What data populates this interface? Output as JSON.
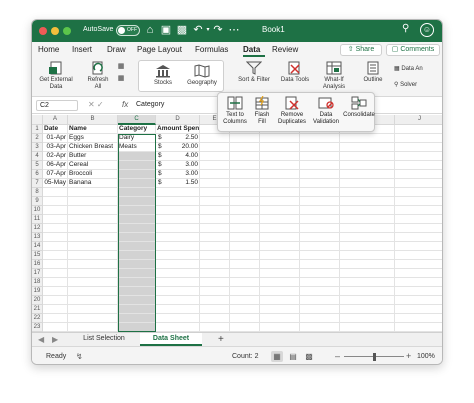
{
  "title_bar": {
    "autosave_label": "AutoSave",
    "autosave_state": "OFF",
    "document_title": "Book1",
    "icons": [
      "home-icon",
      "save-icon",
      "undo-icon",
      "redo-icon",
      "search-icon",
      "smile-icon"
    ]
  },
  "ribbon_tabs": [
    {
      "label": "Home"
    },
    {
      "label": "Insert"
    },
    {
      "label": "Draw"
    },
    {
      "label": "Page Layout"
    },
    {
      "label": "Formulas"
    },
    {
      "label": "Data",
      "active": true
    },
    {
      "label": "Review"
    }
  ],
  "share": {
    "label": "Share"
  },
  "comments": {
    "label": "Comments"
  },
  "ribbon": {
    "get_external_data": "Get External Data",
    "refresh_all": "Refresh All",
    "stocks": "Stocks",
    "geography": "Geography",
    "sort_filter": "Sort & Filter",
    "data_tools": "Data Tools",
    "what_if": "What-If Analysis",
    "outline": "Outline",
    "data_analysis": "Data An",
    "solver": "Solver"
  },
  "data_tools_popup": {
    "text_to_columns": "Text to Columns",
    "flash_fill": "Flash Fill",
    "remove_duplicates": "Remove Duplicates",
    "data_validation": "Data Validation",
    "consolidate": "Consolidate"
  },
  "formula_bar": {
    "name_box": "C2",
    "fx": "fx",
    "content": "Category"
  },
  "columns": [
    "A",
    "B",
    "C",
    "D",
    "E",
    "F",
    "G",
    "H",
    "I",
    "J"
  ],
  "selected_column": "C",
  "row_count": 23,
  "rows": [
    {
      "num": "1",
      "A": "Date",
      "B": "Name",
      "C": "Category",
      "D": "Amount Spent"
    },
    {
      "num": "2",
      "A": "01-Apr",
      "B": "Eggs",
      "C": "Dairy",
      "D_cur": "$",
      "D": "2.50"
    },
    {
      "num": "3",
      "A": "03-Apr",
      "B": "Chicken Breast",
      "C": "Meats",
      "D_cur": "$",
      "D": "20.00"
    },
    {
      "num": "4",
      "A": "02-Apr",
      "B": "Butter",
      "C": "",
      "D_cur": "$",
      "D": "4.00"
    },
    {
      "num": "5",
      "A": "06-Apr",
      "B": "Cereal",
      "C": "",
      "D_cur": "$",
      "D": "3.00"
    },
    {
      "num": "6",
      "A": "07-Apr",
      "B": "Broccoli",
      "C": "",
      "D_cur": "$",
      "D": "3.00"
    },
    {
      "num": "7",
      "A": "05-May",
      "B": "Banana",
      "C": "",
      "D_cur": "$",
      "D": "1.50"
    }
  ],
  "sheets": [
    {
      "label": "List Selection"
    },
    {
      "label": "Data Sheet",
      "active": true
    }
  ],
  "sheet_add": "+",
  "status": {
    "ready": "Ready",
    "count": "Count: 2",
    "zoom": "100%",
    "zoom_fraction": 0.5
  },
  "colors": {
    "accent": "#1e7145",
    "selection_fill": "#d2d2d2"
  }
}
